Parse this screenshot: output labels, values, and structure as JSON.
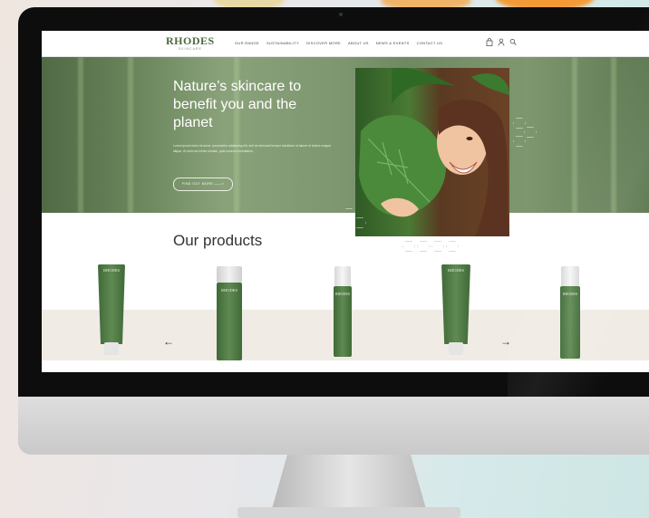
{
  "nav": {
    "brand": "RHODES",
    "brand_sub": "SKINCARE",
    "items": [
      "OUR RANGE",
      "SUSTAINABILITY",
      "DISCOVER MORE",
      "ABOUT US",
      "NEWS & EVENTS",
      "CONTACT US"
    ],
    "icons": [
      "bag-icon",
      "user-icon",
      "search-icon"
    ]
  },
  "hero": {
    "title": "Nature’s skincare to benefit you and the planet",
    "body": "Lorem ipsum dolor sit amet, consectetur adipiscing elit, sed do eiusmod tempor incididunt ut labore et dolore magna aliqua. Ut enim ad minim veniam, quis nostrud exercitation.",
    "button": "FIND OUT MORE  ——>"
  },
  "products": {
    "title": "Our products",
    "items": [
      {
        "brand": "RHODES"
      },
      {
        "brand": "RHODES"
      },
      {
        "brand": "RHODES"
      },
      {
        "brand": "RHODES"
      },
      {
        "brand": "RHODES"
      }
    ],
    "prev_arrow": "←",
    "next_arrow": "→"
  },
  "colors": {
    "brand_green": "#4a6b3c",
    "product_green": "#4f7a45"
  }
}
